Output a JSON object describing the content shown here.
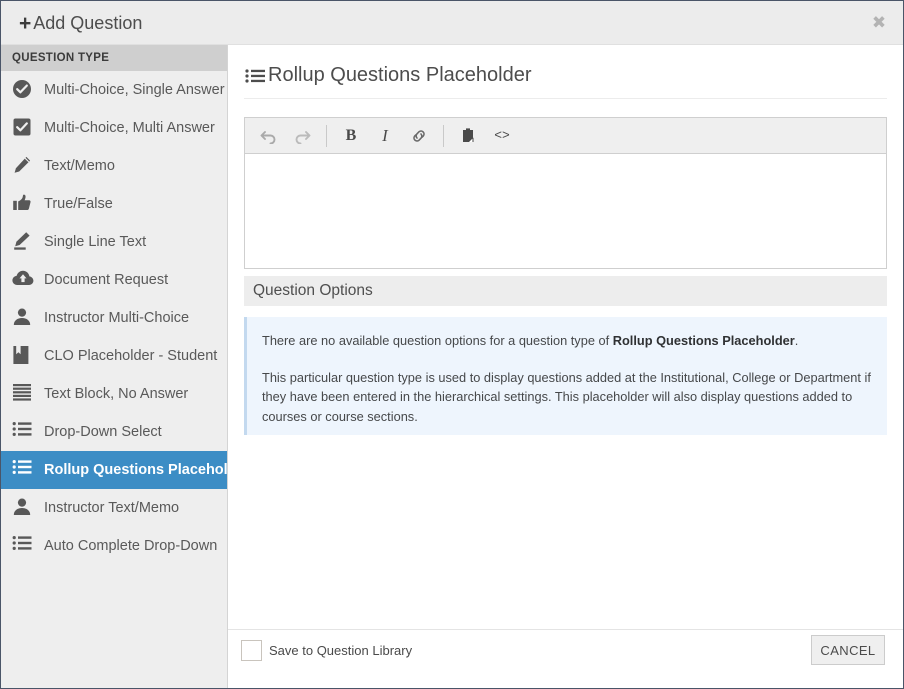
{
  "header": {
    "title": "Add Question",
    "plus_icon": "plus-icon",
    "close_icon": "✖"
  },
  "sidebar": {
    "heading": "QUESTION TYPE",
    "items": [
      {
        "label": "Multi-Choice, Single Answer",
        "icon": "check-circle-icon",
        "active": false
      },
      {
        "label": "Multi-Choice, Multi Answer",
        "icon": "check-square-icon",
        "active": false
      },
      {
        "label": "Text/Memo",
        "icon": "pencil-icon",
        "active": false
      },
      {
        "label": "True/False",
        "icon": "thumbs-up-icon",
        "active": false
      },
      {
        "label": "Single Line Text",
        "icon": "pencil-underline-icon",
        "active": false
      },
      {
        "label": "Document Request",
        "icon": "cloud-upload-icon",
        "active": false
      },
      {
        "label": "Instructor Multi-Choice",
        "icon": "person-icon",
        "active": false
      },
      {
        "label": "CLO Placeholder - Student",
        "icon": "bookmark-icon",
        "active": false
      },
      {
        "label": "Text Block, No Answer",
        "icon": "text-lines-icon",
        "active": false
      },
      {
        "label": "Drop-Down Select",
        "icon": "bullet-list-icon",
        "active": false
      },
      {
        "label": "Rollup Questions Placeholder",
        "icon": "bullet-list-icon",
        "active": true
      },
      {
        "label": "Instructor Text/Memo",
        "icon": "person-icon",
        "active": false
      },
      {
        "label": "Auto Complete Drop-Down",
        "icon": "bullet-list-icon",
        "active": false
      }
    ]
  },
  "main": {
    "title": "Rollup Questions Placeholder",
    "title_icon": "bullet-list-icon",
    "editor": {
      "content": "",
      "placeholder": "",
      "toolbar": [
        {
          "name": "undo-button",
          "glyph": "↩",
          "kind": "dim"
        },
        {
          "name": "redo-button",
          "glyph": "↪",
          "kind": "dim"
        },
        {
          "name": "bold-button",
          "glyph": "B",
          "kind": "bold"
        },
        {
          "name": "italic-button",
          "glyph": "I",
          "kind": "italic"
        },
        {
          "name": "link-button",
          "glyph": "🔗",
          "kind": "link"
        },
        {
          "name": "paste-button",
          "glyph": "📋",
          "kind": "paste"
        },
        {
          "name": "source-code-button",
          "glyph": "<>",
          "kind": "code"
        }
      ]
    },
    "question_options": {
      "header": "Question Options",
      "info_line_prefix": "There are no available question options for a question type of ",
      "info_line_strong": "Rollup Questions Placeholder",
      "info_line_suffix": ".",
      "info_paragraph": "This particular question type is used to display questions added at the Institutional, College or Department if they have been entered in the hierarchical settings. This placeholder will also display questions added to courses or course sections."
    }
  },
  "footer": {
    "save_to_library_label": "Save to Question Library",
    "save_to_library_checked": false,
    "cancel_label": "CANCEL"
  },
  "colors": {
    "accent_blue": "#3c8dc5",
    "header_bg": "#ececec",
    "sidebar_bg": "#eeeeee",
    "sidebar_heading_bg": "#cfcfcf",
    "info_bg": "#eef5fd",
    "dialog_border": "#4a5568"
  }
}
